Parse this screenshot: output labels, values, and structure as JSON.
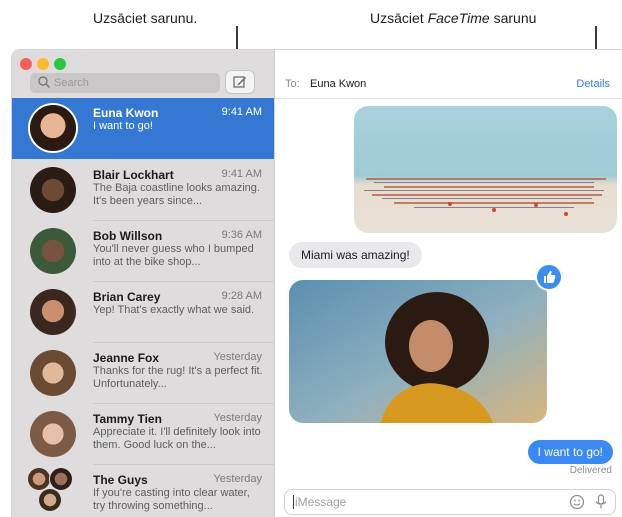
{
  "callouts": {
    "new_conversation": "Uzsāciet sarunu.",
    "facetime_prefix": "Uzsāciet ",
    "facetime_italic": "FaceTime",
    "facetime_suffix": " sarunu"
  },
  "sidebar": {
    "search_placeholder": "Search",
    "conversations": [
      {
        "name": "Euna Kwon",
        "time": "9:41 AM",
        "preview": "I want to go!",
        "selected": true
      },
      {
        "name": "Blair Lockhart",
        "time": "9:41 AM",
        "preview": "The Baja coastline looks amazing. It's been years since..."
      },
      {
        "name": "Bob Willson",
        "time": "9:36 AM",
        "preview": "You'll never guess who I bumped into at the bike shop..."
      },
      {
        "name": "Brian Carey",
        "time": "9:28 AM",
        "preview": "Yep! That's exactly what we said."
      },
      {
        "name": "Jeanne Fox",
        "time": "Yesterday",
        "preview": "Thanks for the rug! It's a perfect fit. Unfortunately..."
      },
      {
        "name": "Tammy Tien",
        "time": "Yesterday",
        "preview": "Appreciate it. I'll definitely look into them. Good luck on the..."
      },
      {
        "name": "The Guys",
        "time": "Yesterday",
        "preview": "If you're casting into clear water, try throwing something..."
      }
    ]
  },
  "header": {
    "to_label": "To:",
    "to_name": "Euna Kwon",
    "details": "Details"
  },
  "messages": {
    "received_text": "Miami was amazing!",
    "sent_text": "I want to go!",
    "status": "Delivered"
  },
  "input": {
    "placeholder": "iMessage"
  },
  "colors": {
    "accent": "#3478d4",
    "sent_bubble": "#3a89f2",
    "received_bubble": "#e9e9eb"
  },
  "icons": {
    "search": "search-icon",
    "compose": "compose-icon",
    "tapback": "thumbs-up-icon",
    "emoji": "emoji-icon",
    "mic": "microphone-icon"
  }
}
